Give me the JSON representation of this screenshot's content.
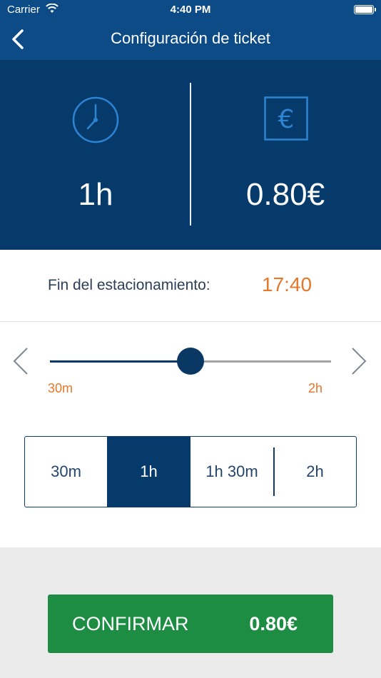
{
  "status_bar": {
    "carrier": "Carrier",
    "time": "4:40 PM"
  },
  "nav": {
    "title": "Configuración de ticket",
    "back_icon": "chevron-left-icon"
  },
  "summary": {
    "duration_icon": "clock-icon",
    "duration": "1h",
    "price_icon": "euro-icon",
    "price": "0.80€"
  },
  "end": {
    "label": "Fin del estacionamiento:",
    "time": "17:40"
  },
  "slider": {
    "min_label": "30m",
    "max_label": "2h",
    "value_fraction": 0.5,
    "prev_icon": "chevron-left-icon",
    "next_icon": "chevron-right-icon"
  },
  "options": [
    {
      "label": "30m",
      "selected": false
    },
    {
      "label": "1h",
      "selected": true
    },
    {
      "label": "1h 30m",
      "selected": false
    },
    {
      "label": "2h",
      "selected": false
    }
  ],
  "confirm": {
    "label": "CONFIRMAR",
    "price": "0.80€"
  },
  "colors": {
    "nav_bg": "#0d4b86",
    "panel_bg": "#063a6a",
    "accent_orange": "#e5772a",
    "confirm_green": "#1c8d43",
    "footer_bg": "#ebebeb"
  }
}
